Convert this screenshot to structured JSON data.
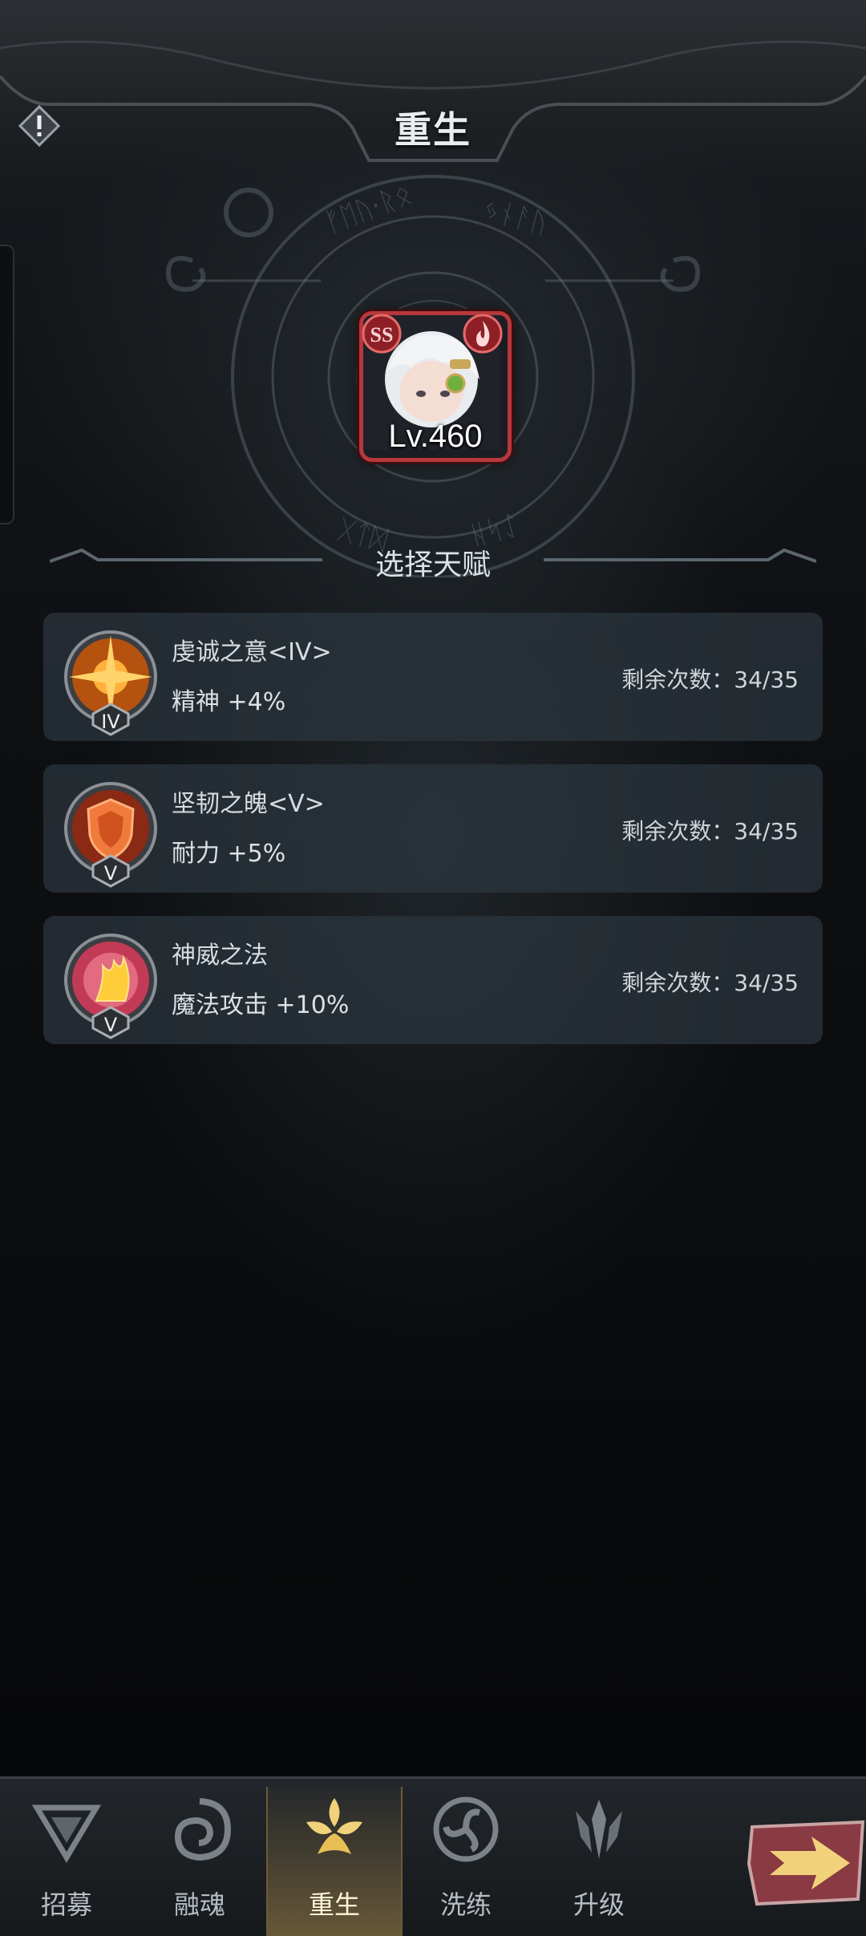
{
  "header": {
    "title": "重生",
    "info_icon": "info-alert-icon"
  },
  "hero": {
    "level": "Lv.460",
    "rank_badge": "SS",
    "element_icon": "fire-element-icon"
  },
  "section_title": "选择天赋",
  "talents": [
    {
      "name": "虔诚之意<IV>",
      "effect": "精神 +4%",
      "remaining": "剩余次数：34/35",
      "grade": "IV",
      "icon": "sun-star-icon"
    },
    {
      "name": "坚韧之魄<V>",
      "effect": "耐力 +5%",
      "remaining": "剩余次数：34/35",
      "grade": "V",
      "icon": "shield-icon"
    },
    {
      "name": "神威之法",
      "effect": "魔法攻击 +10%",
      "remaining": "剩余次数：34/35",
      "grade": "V",
      "icon": "magic-flame-icon"
    }
  ],
  "bottom_nav": [
    {
      "label": "招募",
      "icon": "recruit-triangle-icon",
      "active": false
    },
    {
      "label": "融魂",
      "icon": "soul-swirl-icon",
      "active": false
    },
    {
      "label": "重生",
      "icon": "rebirth-lotus-icon",
      "active": true
    },
    {
      "label": "洗练",
      "icon": "triskelion-icon",
      "active": false
    },
    {
      "label": "升级",
      "icon": "upgrade-crown-icon",
      "active": false
    }
  ],
  "next_button_icon": "arrow-right-icon",
  "colors": {
    "accent_gold": "#f1d27a",
    "rank_red": "#b8373c",
    "panel": "#2c363f"
  }
}
